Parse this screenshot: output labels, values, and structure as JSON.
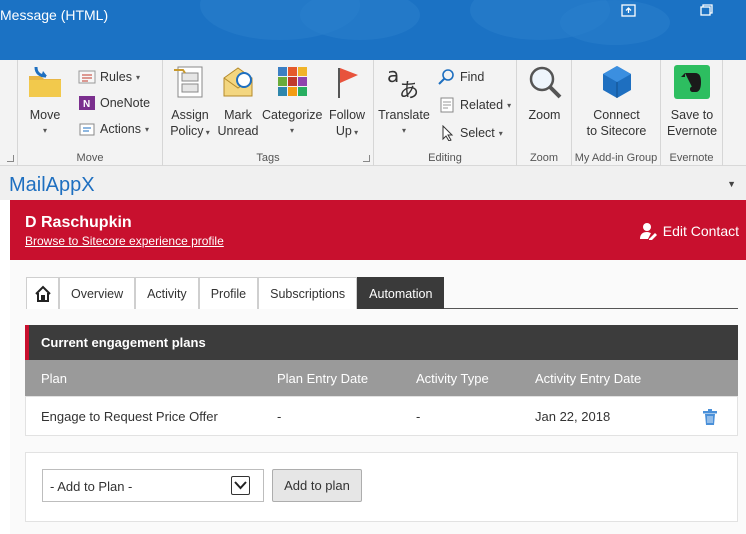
{
  "window": {
    "title": "Message (HTML)"
  },
  "ribbon": {
    "move_group": {
      "label": "Move",
      "move": "Move",
      "rules": "Rules",
      "onenote": "OneNote",
      "actions": "Actions"
    },
    "tags_group": {
      "label": "Tags",
      "assign_policy": [
        "Assign",
        "Policy"
      ],
      "mark_unread": [
        "Mark",
        "Unread"
      ],
      "categorize": "Categorize",
      "follow_up": [
        "Follow",
        "Up"
      ]
    },
    "editing_group": {
      "label": "Editing",
      "translate": "Translate",
      "find": "Find",
      "related": "Related",
      "select": "Select"
    },
    "zoom_group": {
      "label": "Zoom",
      "zoom": "Zoom"
    },
    "addin_group": {
      "label": "My Add-in Group",
      "connect": [
        "Connect",
        "to Sitecore"
      ]
    },
    "evernote_group": {
      "label": "Evernote",
      "save": [
        "Save to",
        "Evernote"
      ]
    }
  },
  "addin": {
    "title": "MailAppX"
  },
  "contact": {
    "name": "D Raschupkin",
    "link": "Browse to Sitecore experience profile",
    "edit": "Edit Contact"
  },
  "tabs": [
    "Overview",
    "Activity",
    "Profile",
    "Subscriptions",
    "Automation"
  ],
  "active_tab": "Automation",
  "plans": {
    "title": "Current engagement plans",
    "columns": [
      "Plan",
      "Plan Entry Date",
      "Activity Type",
      "Activity Entry Date"
    ],
    "rows": [
      {
        "plan": "Engage to Request Price Offer",
        "plan_entry_date": "-",
        "activity_type": "-",
        "activity_entry_date": "Jan 22, 2018"
      }
    ]
  },
  "add": {
    "select_value": "- Add to Plan -",
    "button": "Add to plan"
  },
  "colors": {
    "titlebar": "#1b72c4",
    "contact_bar": "#c8102e",
    "accent": "#1e6fc0"
  }
}
